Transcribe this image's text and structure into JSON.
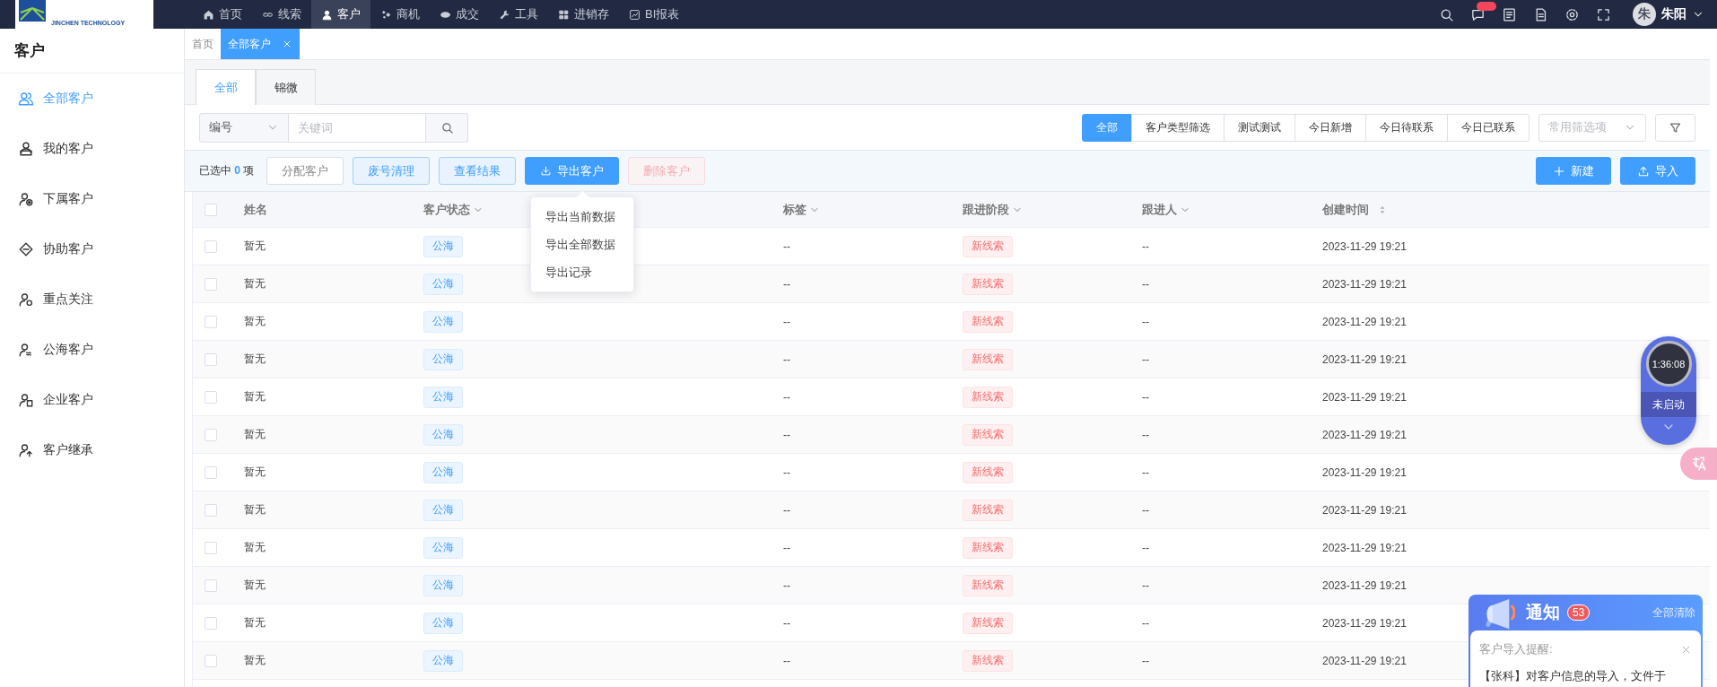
{
  "topbar": {
    "logo_text": "JINCHEN TECHNOLOGY",
    "nav": [
      {
        "label": "首页",
        "selected": false
      },
      {
        "label": "线索",
        "selected": false
      },
      {
        "label": "客户",
        "selected": true
      },
      {
        "label": "商机",
        "selected": false
      },
      {
        "label": "成交",
        "selected": false
      },
      {
        "label": "工具",
        "selected": false
      },
      {
        "label": "进销存",
        "selected": false
      },
      {
        "label": "BI报表",
        "selected": false
      }
    ],
    "user": {
      "avatar": "朱",
      "name": "朱阳"
    }
  },
  "sidebar": {
    "title": "客户",
    "items": [
      {
        "label": "全部客户",
        "selected": true
      },
      {
        "label": "我的客户",
        "selected": false
      },
      {
        "label": "下属客户",
        "selected": false
      },
      {
        "label": "协助客户",
        "selected": false
      },
      {
        "label": "重点关注",
        "selected": false
      },
      {
        "label": "公海客户",
        "selected": false
      },
      {
        "label": "企业客户",
        "selected": false
      },
      {
        "label": "客户继承",
        "selected": false
      }
    ]
  },
  "page_tabs": [
    {
      "label": "首页",
      "selected": false
    },
    {
      "label": "全部客户",
      "selected": true
    }
  ],
  "sub_tabs": [
    {
      "label": "全部",
      "selected": true
    },
    {
      "label": "锦微",
      "selected": false
    }
  ],
  "search": {
    "field": "编号",
    "placeholder": "关键词"
  },
  "filters": [
    {
      "label": "全部",
      "selected": true
    },
    {
      "label": "客户类型筛选",
      "selected": false
    },
    {
      "label": "测试测试",
      "selected": false
    },
    {
      "label": "今日新增",
      "selected": false
    },
    {
      "label": "今日待联系",
      "selected": false
    },
    {
      "label": "今日已联系",
      "selected": false
    }
  ],
  "filter_select": {
    "placeholder": "常用筛选项"
  },
  "selection": {
    "prefix": "已选中",
    "count": "0",
    "suffix": "项"
  },
  "actions": [
    {
      "label": "分配客户",
      "kind": "plain",
      "disabled": false
    },
    {
      "label": "废号清理",
      "kind": "light",
      "disabled": false
    },
    {
      "label": "查看结果",
      "kind": "light",
      "disabled": false
    },
    {
      "label": "导出客户",
      "kind": "primary",
      "disabled": false
    },
    {
      "label": "删除客户",
      "kind": "danger",
      "disabled": true
    }
  ],
  "right_actions": [
    {
      "label": "新建"
    },
    {
      "label": "导入"
    }
  ],
  "export_menu": [
    {
      "label": "导出当前数据"
    },
    {
      "label": "导出全部数据"
    },
    {
      "label": "导出记录"
    }
  ],
  "table": {
    "all_checked": false,
    "columns": [
      {
        "label": "姓名"
      },
      {
        "label": "客户状态"
      },
      {
        "label": "标签"
      },
      {
        "label": "跟进阶段"
      },
      {
        "label": "跟进人"
      },
      {
        "label": "创建时间"
      }
    ],
    "rows": [
      {
        "checked": false,
        "name": "暂无",
        "status": "公海",
        "tag": "--",
        "stage": "新线索",
        "owner": "--",
        "created": "2023-11-29 19:21"
      },
      {
        "checked": false,
        "name": "暂无",
        "status": "公海",
        "tag": "--",
        "stage": "新线索",
        "owner": "--",
        "created": "2023-11-29 19:21"
      },
      {
        "checked": false,
        "name": "暂无",
        "status": "公海",
        "tag": "--",
        "stage": "新线索",
        "owner": "--",
        "created": "2023-11-29 19:21"
      },
      {
        "checked": false,
        "name": "暂无",
        "status": "公海",
        "tag": "--",
        "stage": "新线索",
        "owner": "--",
        "created": "2023-11-29 19:21"
      },
      {
        "checked": false,
        "name": "暂无",
        "status": "公海",
        "tag": "--",
        "stage": "新线索",
        "owner": "--",
        "created": "2023-11-29 19:21"
      },
      {
        "checked": false,
        "name": "暂无",
        "status": "公海",
        "tag": "--",
        "stage": "新线索",
        "owner": "--",
        "created": "2023-11-29 19:21"
      },
      {
        "checked": false,
        "name": "暂无",
        "status": "公海",
        "tag": "--",
        "stage": "新线索",
        "owner": "--",
        "created": "2023-11-29 19:21"
      },
      {
        "checked": false,
        "name": "暂无",
        "status": "公海",
        "tag": "--",
        "stage": "新线索",
        "owner": "--",
        "created": "2023-11-29 19:21"
      },
      {
        "checked": false,
        "name": "暂无",
        "status": "公海",
        "tag": "--",
        "stage": "新线索",
        "owner": "--",
        "created": "2023-11-29 19:21"
      },
      {
        "checked": false,
        "name": "暂无",
        "status": "公海",
        "tag": "--",
        "stage": "新线索",
        "owner": "--",
        "created": "2023-11-29 19:21"
      },
      {
        "checked": false,
        "name": "暂无",
        "status": "公海",
        "tag": "--",
        "stage": "新线索",
        "owner": "--",
        "created": "2023-11-29 19:21"
      },
      {
        "checked": false,
        "name": "暂无",
        "status": "公海",
        "tag": "--",
        "stage": "新线索",
        "owner": "--",
        "created": "2023-11-29 19:21"
      }
    ]
  },
  "timer": {
    "time": "1:36:08",
    "status": "未启动"
  },
  "notification": {
    "title": "通知",
    "count": "53",
    "clear": "全部清除",
    "items": [
      {
        "title": "客户导入提醒:",
        "body": "【张科】对客户信息的导入，文件于"
      }
    ]
  }
}
